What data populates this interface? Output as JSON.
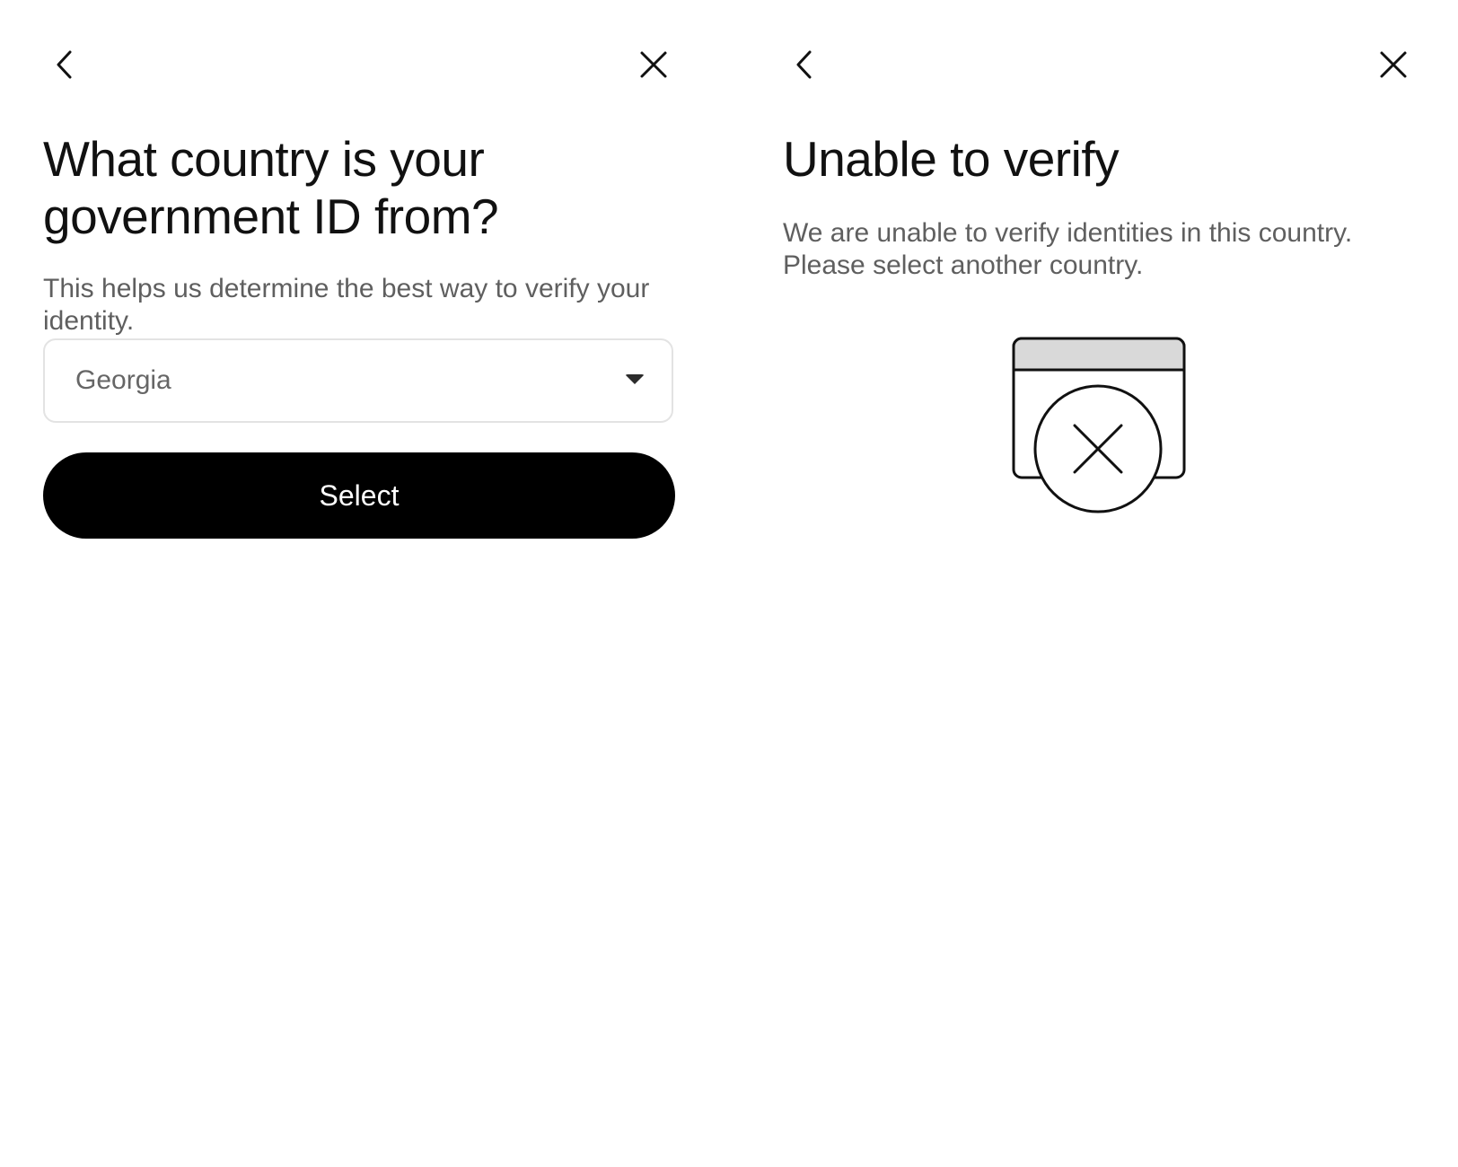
{
  "screens": {
    "country_select": {
      "title": "What country is your government ID from?",
      "subtitle": "This helps us determine the best way to verify your identity.",
      "country_field": {
        "value": "Georgia"
      },
      "select_button": "Select"
    },
    "unable_to_verify": {
      "title": "Unable to verify",
      "subtitle": "We are unable to verify identities in this country. Please select another country.",
      "illustration": "id-document-error-icon"
    }
  },
  "icons": {
    "back": "chevron-left-icon",
    "close": "close-icon",
    "dropdown": "caret-down-icon"
  },
  "colors": {
    "primary_button": "#000000",
    "text_primary": "#111111",
    "text_secondary": "#5f5f5f",
    "field_border": "#e3e3e3",
    "illustration_header": "#d9d9d9"
  }
}
